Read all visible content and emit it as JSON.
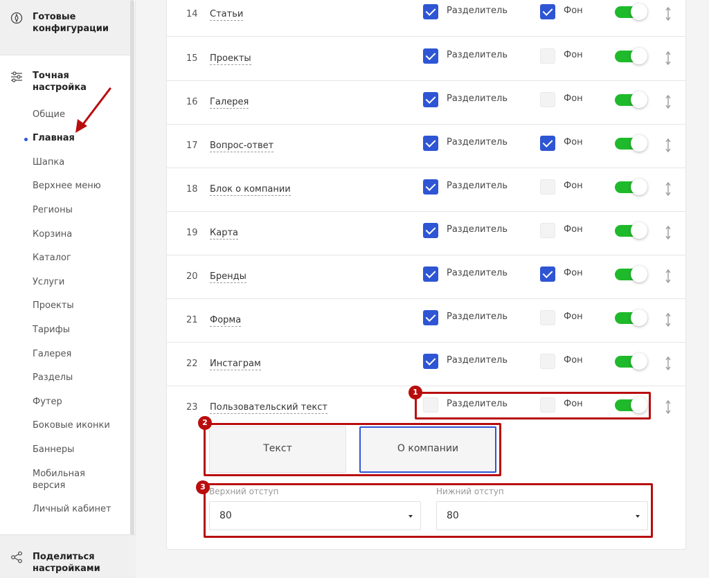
{
  "sidebar": {
    "ready_configs": "Готовые конфигурации",
    "fine_tuning": "Точная настройка",
    "items": [
      "Общие",
      "Главная",
      "Шапка",
      "Верхнее меню",
      "Регионы",
      "Корзина",
      "Каталог",
      "Услуги",
      "Проекты",
      "Тарифы",
      "Галерея",
      "Разделы",
      "Футер",
      "Боковые иконки",
      "Баннеры",
      "Мобильная версия",
      "Личный кабинет"
    ],
    "active_item": "Главная",
    "share": "Поделиться настройками"
  },
  "blocks_table": {
    "separator_label": "Разделитель",
    "background_label": "Фон",
    "rows": [
      {
        "num": "14",
        "name": "Статьи",
        "separator": true,
        "background": true,
        "enabled": true
      },
      {
        "num": "15",
        "name": "Проекты",
        "separator": true,
        "background": false,
        "enabled": true
      },
      {
        "num": "16",
        "name": "Галерея",
        "separator": true,
        "background": false,
        "enabled": true
      },
      {
        "num": "17",
        "name": "Вопрос-ответ",
        "separator": true,
        "background": true,
        "enabled": true
      },
      {
        "num": "18",
        "name": "Блок о компании",
        "separator": true,
        "background": false,
        "enabled": true
      },
      {
        "num": "19",
        "name": "Карта",
        "separator": true,
        "background": false,
        "enabled": true
      },
      {
        "num": "20",
        "name": "Бренды",
        "separator": true,
        "background": true,
        "enabled": true
      },
      {
        "num": "21",
        "name": "Форма",
        "separator": true,
        "background": false,
        "enabled": true
      },
      {
        "num": "22",
        "name": "Инстаграм",
        "separator": true,
        "background": false,
        "enabled": true
      },
      {
        "num": "23",
        "name": "Пользовательский текст",
        "separator": false,
        "background": false,
        "enabled": true
      }
    ]
  },
  "custom_text": {
    "tabs": [
      "Текст",
      "О компании"
    ],
    "selected_tab": "О компании",
    "top_margin_label": "Верхний отступ",
    "top_margin_value": "80",
    "bottom_margin_label": "Нижний отступ",
    "bottom_margin_value": "80"
  },
  "annotations": [
    "1",
    "2",
    "3"
  ],
  "colors": {
    "accent": "#2e55d4",
    "toggle_on": "#1fba2c",
    "annotation": "#b90d0d"
  }
}
